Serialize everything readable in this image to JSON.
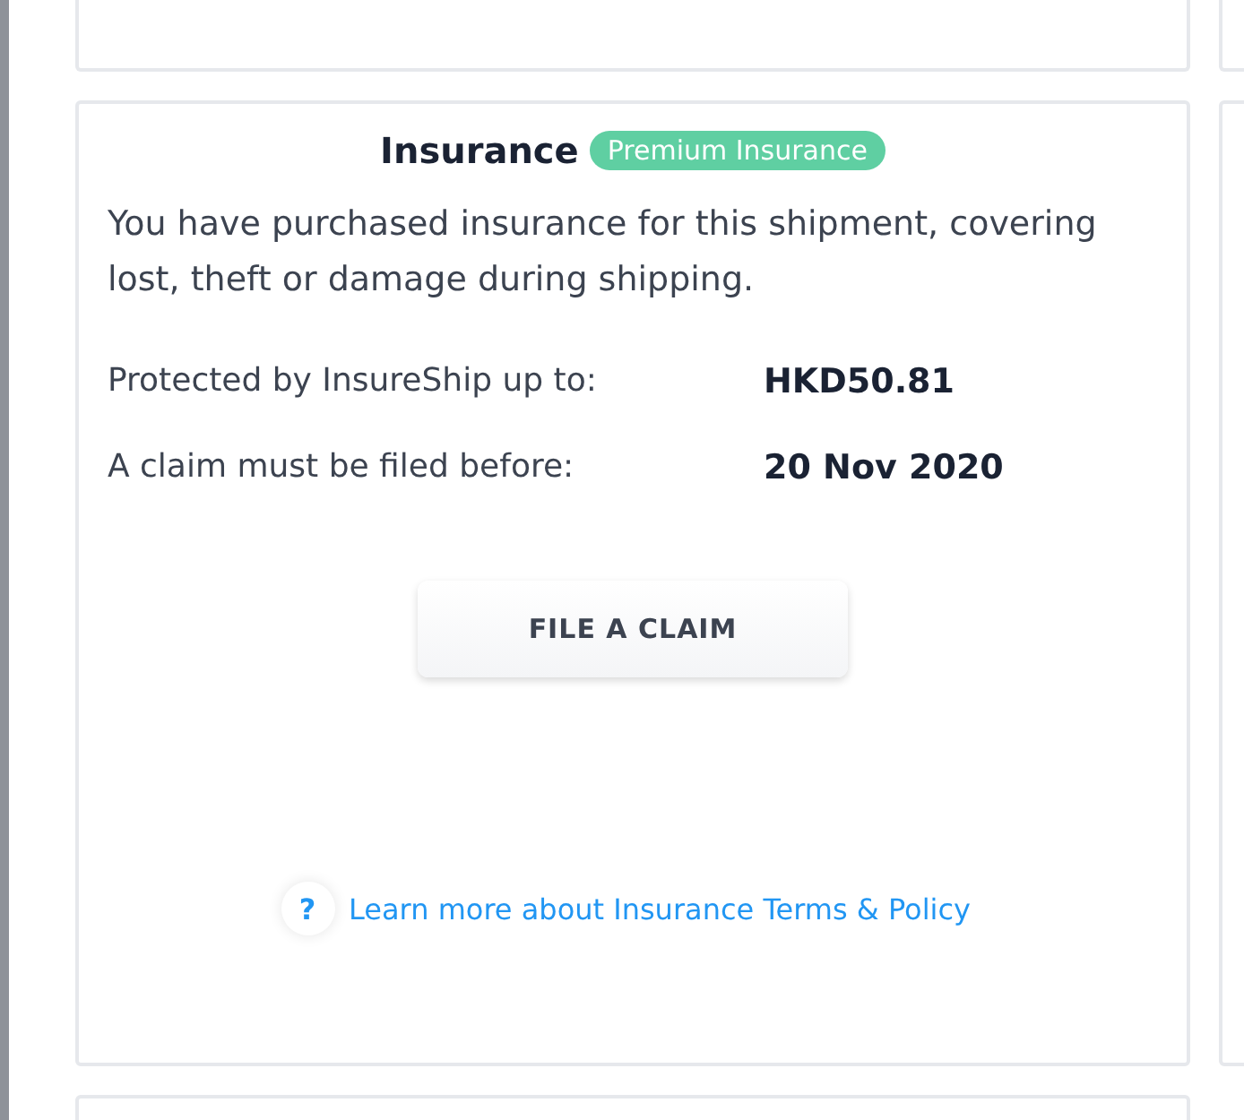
{
  "insurance": {
    "title": "Insurance",
    "badge": "Premium Insurance",
    "description": "You have purchased insurance for this shipment, covering lost, theft or damage during shipping.",
    "details": [
      {
        "label": "Protected by InsureShip up to:",
        "value": "HKD50.81"
      },
      {
        "label": "A claim must be filed before:",
        "value": "20 Nov 2020"
      }
    ],
    "button": "FILE A CLAIM",
    "help_mark": "?",
    "link": "Learn more about Insurance Terms & Policy"
  }
}
